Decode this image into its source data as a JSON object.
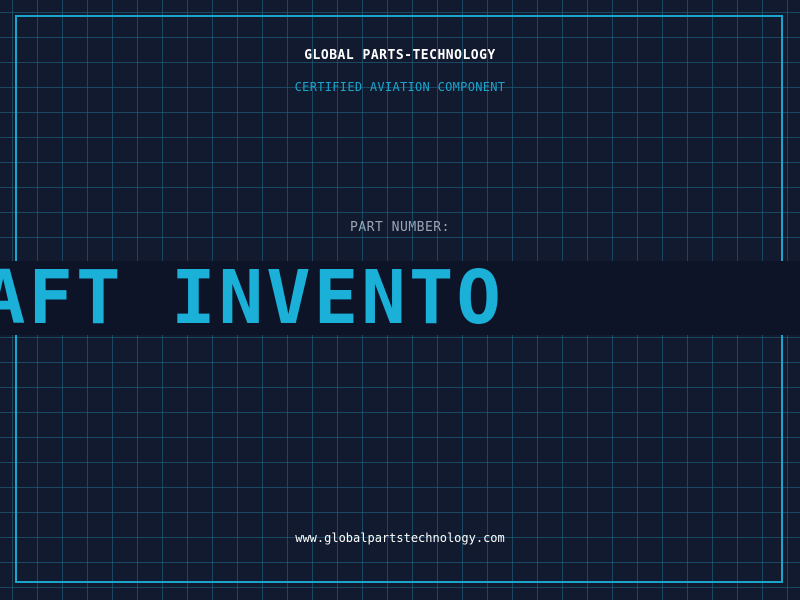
{
  "header": {
    "company_name": "GLOBAL PARTS-TECHNOLOGY",
    "subtitle": "CERTIFIED AVIATION COMPONENT"
  },
  "part": {
    "label": "PART NUMBER:",
    "banner_text": "N AIRCRAFT INVENTO"
  },
  "footer": {
    "website": "www.globalpartstechnology.com"
  },
  "colors": {
    "background": "#111a2e",
    "accent": "#1ba4cc",
    "banner_text": "#1ab0d8",
    "label": "#9aa6b8"
  }
}
